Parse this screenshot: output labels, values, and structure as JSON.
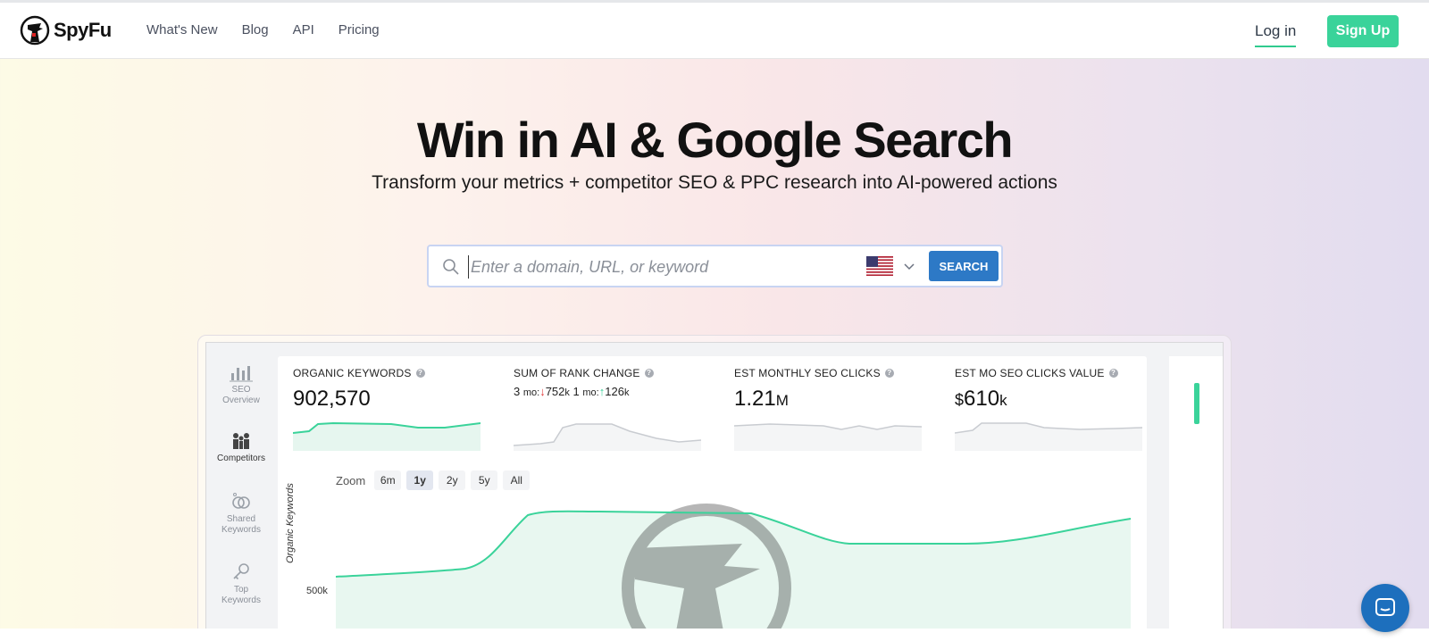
{
  "brand": {
    "name": "SpyFu",
    "accent": "#3ad39a",
    "primary": "#2d79c6"
  },
  "nav": {
    "items": [
      "What's New",
      "Blog",
      "API",
      "Pricing"
    ],
    "login": "Log in",
    "signup": "Sign Up"
  },
  "hero": {
    "title": "Win in AI & Google Search",
    "subtitle": "Transform your metrics + competitor SEO & PPC research into AI-powered actions"
  },
  "search": {
    "placeholder": "Enter a domain, URL, or keyword",
    "button": "SEARCH",
    "country_icon": "us-flag-icon"
  },
  "preview": {
    "sidebar": [
      {
        "line1": "SEO",
        "line2": "Overview",
        "icon": "bar-chart-icon",
        "active": false
      },
      {
        "line1": "Competitors",
        "line2": "",
        "icon": "competitors-icon",
        "active": true
      },
      {
        "line1": "Shared",
        "line2": "Keywords",
        "icon": "shared-keywords-icon",
        "active": false
      },
      {
        "line1": "Top",
        "line2": "Keywords",
        "icon": "key-icon",
        "active": false
      }
    ],
    "metrics": [
      {
        "label": "ORGANIC KEYWORDS",
        "value": "902,570"
      },
      {
        "label": "SUM OF RANK CHANGE",
        "rank": {
          "n1": "3",
          "mo1": "mo:",
          "down": "752",
          "k1": "k",
          "n2": "1",
          "mo2": "mo:",
          "up": "126",
          "k2": "k"
        }
      },
      {
        "label": "EST MONTHLY SEO CLICKS",
        "value": "1.21",
        "unit": "M"
      },
      {
        "label": "EST MO SEO CLICKS VALUE",
        "currency": "$",
        "value": "610",
        "unit": "k"
      }
    ],
    "zoom": {
      "label": "Zoom",
      "options": [
        "6m",
        "1y",
        "2y",
        "5y",
        "All"
      ],
      "selected": "1y"
    },
    "chart": {
      "ylabel": "Organic Keywords",
      "tick": "500k"
    }
  }
}
